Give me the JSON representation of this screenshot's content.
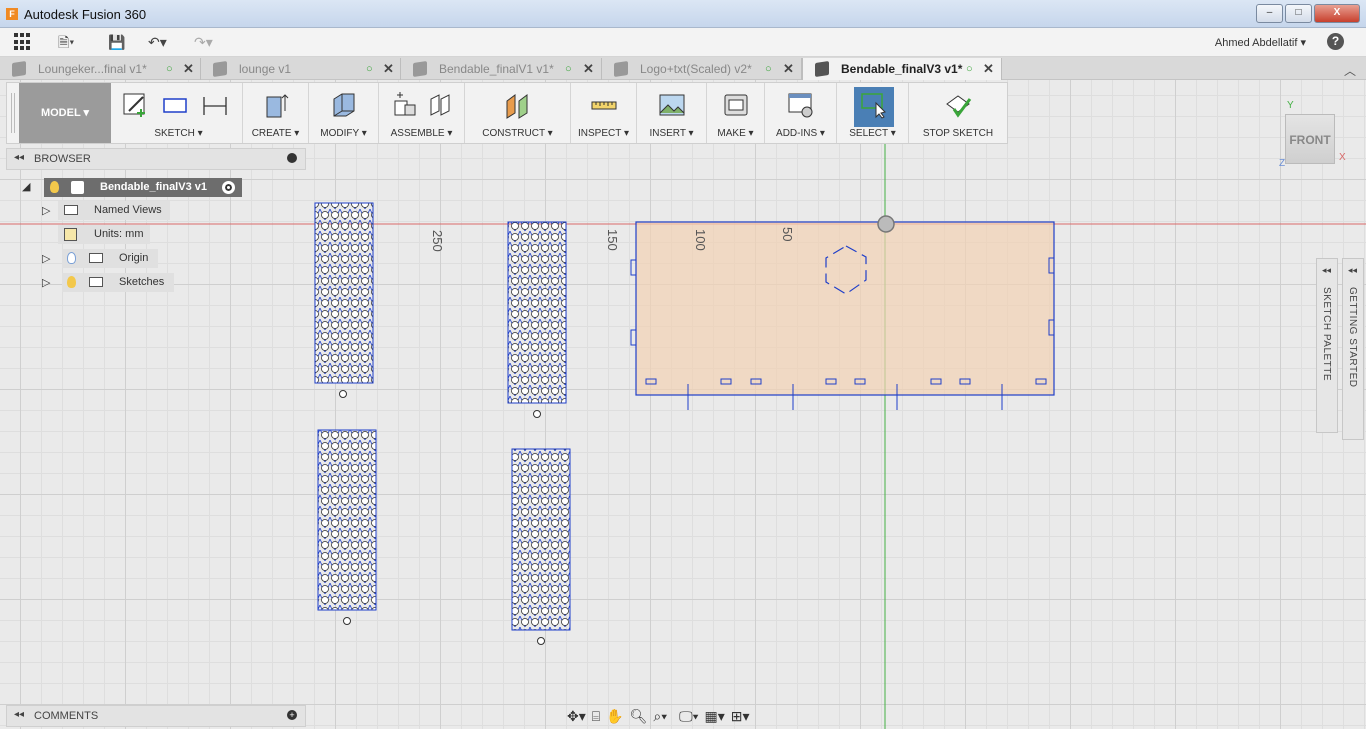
{
  "window": {
    "title": "Autodesk Fusion 360",
    "logo_letter": "F",
    "minimize": "–",
    "maximize": "□",
    "close": "X"
  },
  "appbar": {
    "user": "Ahmed Abdellatif ▾",
    "help": "?"
  },
  "tabs": [
    {
      "label": "Loungeker...final v1*"
    },
    {
      "label": "lounge v1"
    },
    {
      "label": "Bendable_finalV1 v1*"
    },
    {
      "label": "Logo+txt(Scaled) v2*"
    },
    {
      "label": "Bendable_finalV3 v1*"
    }
  ],
  "ribbon": {
    "mode": "MODEL ▾",
    "groups": {
      "sketch": "SKETCH ▾",
      "create": "CREATE ▾",
      "modify": "MODIFY ▾",
      "assemble": "ASSEMBLE ▾",
      "construct": "CONSTRUCT ▾",
      "inspect": "INSPECT ▾",
      "insert": "INSERT ▾",
      "make": "MAKE ▾",
      "addins": "ADD-INS ▾",
      "select": "SELECT ▾",
      "stop_sketch": "STOP SKETCH"
    }
  },
  "browser": {
    "title": "BROWSER",
    "collapse": "◂◂",
    "root": "Bendable_finalV3 v1",
    "items": [
      {
        "label": "Named Views"
      },
      {
        "label": "Units: mm"
      },
      {
        "label": "Origin"
      },
      {
        "label": "Sketches"
      }
    ]
  },
  "comments": {
    "title": "COMMENTS",
    "collapse": "◂◂",
    "add": "+"
  },
  "palettes": {
    "sketch_palette": "SKETCH PALETTE",
    "getting_started": "GETTING STARTED",
    "collapse": "◂◂"
  },
  "viewcube": {
    "face": "FRONT",
    "x": "X",
    "y": "Y",
    "z": "Z"
  },
  "dimensions": {
    "d250": "250",
    "d150": "150",
    "d100": "100",
    "d50": "50"
  },
  "colors": {
    "sketch_line": "#1f3fc9",
    "x_axis": "#d96a6a",
    "y_axis": "#44b044",
    "profile_fill": "#f2d2b4",
    "accent_select": "#4a7fb5"
  }
}
